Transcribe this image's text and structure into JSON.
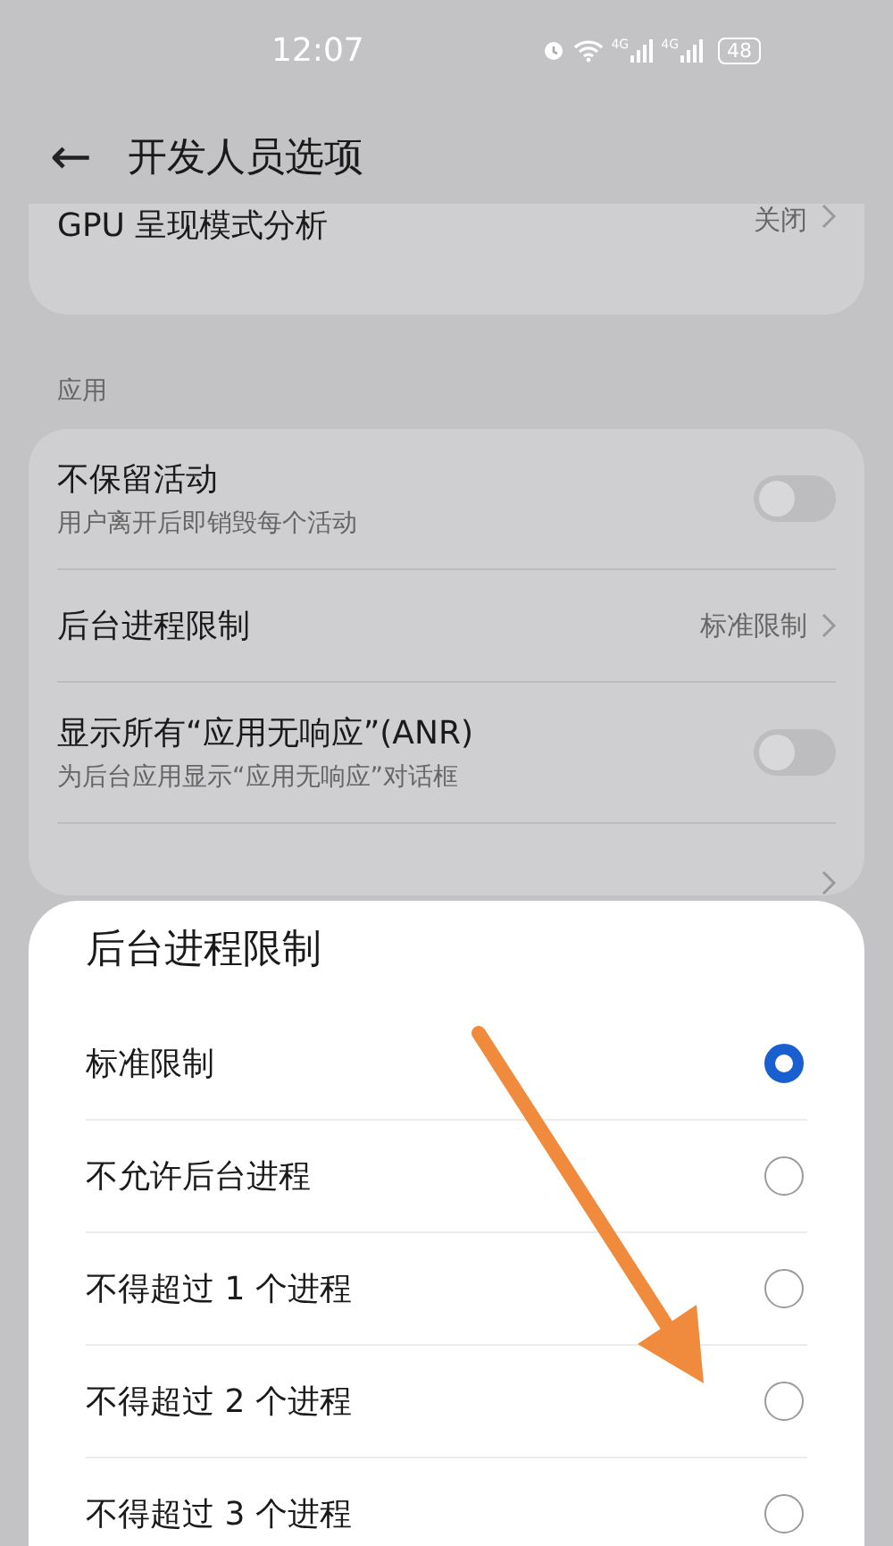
{
  "status_bar": {
    "time": "12:07",
    "network_1": "4G",
    "network_2": "4G",
    "battery": "48"
  },
  "header": {
    "back": "←",
    "title": "开发人员选项"
  },
  "top_card": {
    "label": "GPU 呈现模式分析",
    "value": "关闭"
  },
  "section": {
    "title": "应用",
    "items": [
      {
        "kind": "toggle",
        "label": "不保留活动",
        "subtitle": "用户离开后即销毁每个活动",
        "on": false
      },
      {
        "kind": "link",
        "label": "后台进程限制",
        "value": "标准限制"
      },
      {
        "kind": "toggle",
        "label": "显示所有“应用无响应”(ANR)",
        "subtitle": "为后台应用显示“应用无响应”对话框",
        "on": false
      },
      {
        "kind": "link_hidden"
      }
    ]
  },
  "sheet": {
    "title": "后台进程限制",
    "options": [
      {
        "label": "标准限制",
        "selected": true
      },
      {
        "label": "不允许后台进程",
        "selected": false
      },
      {
        "label": "不得超过 1 个进程",
        "selected": false
      },
      {
        "label": "不得超过 2 个进程",
        "selected": false
      },
      {
        "label": "不得超过 3 个进程",
        "selected": false
      }
    ]
  }
}
